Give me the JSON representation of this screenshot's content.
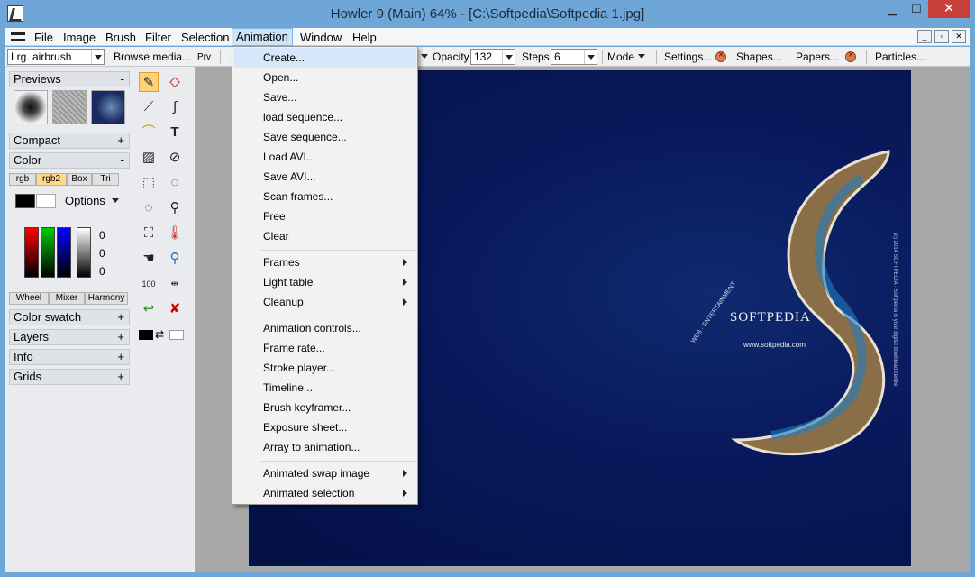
{
  "window": {
    "title": "Howler 9  (Main)   64%   - [C:\\Softpedia\\Softpedia 1.jpg]",
    "min": "▁",
    "max": "☐",
    "close": "✕"
  },
  "menubar": {
    "items": [
      "File",
      "Image",
      "Brush",
      "Filter",
      "Selection",
      "Animation",
      "Window",
      "Help"
    ],
    "active": "Animation",
    "mdi": [
      "_",
      "▫",
      "✕"
    ]
  },
  "toolbar": {
    "brush_select": "Lrg. airbrush",
    "browse_media": "Browse media...",
    "prv": "Prv",
    "opacity_label": "Opacity",
    "opacity_value": "132",
    "steps_label": "Steps",
    "steps_value": "6",
    "mode_label": "Mode",
    "settings_label": "Settings...",
    "shapes_label": "Shapes...",
    "papers_label": "Papers...",
    "particles_label": "Particles..."
  },
  "left_panel": {
    "previews": "Previews",
    "previews_toggle": "-",
    "compact": "Compact",
    "compact_toggle": "+",
    "color": "Color",
    "color_toggle": "-",
    "color_tabs": [
      "rgb",
      "rgb2",
      "Box",
      "Tri"
    ],
    "options": "Options",
    "rgb_values": [
      "0",
      "0",
      "0"
    ],
    "color_modes": [
      "Wheel",
      "Mixer",
      "Harmony"
    ],
    "color_swatch": "Color swatch",
    "layers": "Layers",
    "info": "Info",
    "grids": "Grids",
    "plus": "+"
  },
  "tools": {
    "text_tool": "T",
    "zoom_label": "100"
  },
  "canvas": {
    "logo": "SOFTPEDIA",
    "url": "www.softpedia.com",
    "web_text": "WEB · ENTERTAINMENT",
    "side_text": "(c) 2014 SOFTPEDIA · Softpedia is your digital download centre"
  },
  "dropdown": {
    "group1": [
      "Create...",
      "Open...",
      "Save...",
      "load sequence...",
      "Save sequence...",
      "Load AVI...",
      "Save AVI...",
      "Scan frames...",
      "Free",
      "Clear"
    ],
    "group2": [
      "Frames",
      "Light table",
      "Cleanup"
    ],
    "group3": [
      "Animation controls...",
      "Frame rate...",
      "Stroke player...",
      "Timeline...",
      "Brush keyframer...",
      "Exposure sheet...",
      "Array to animation..."
    ],
    "group4": [
      "Animated swap image",
      "Animated selection"
    ]
  },
  "colors": {
    "title_bar": "#6fa6d8",
    "close_button": "#c7403a",
    "menu_highlight": "#cce4f7",
    "canvas_bg": "#08185a"
  }
}
